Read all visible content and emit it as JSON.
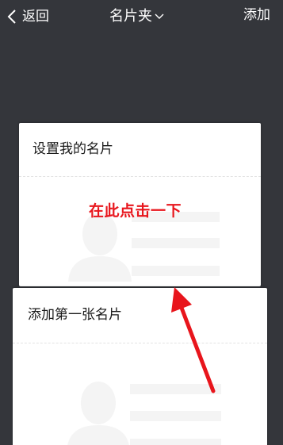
{
  "header": {
    "back_label": "返回",
    "title": "名片夹",
    "add_label": "添加"
  },
  "cards": [
    {
      "title": "设置我的名片"
    },
    {
      "title": "添加第一张名片"
    }
  ],
  "annotation": {
    "text": "在此点击一下",
    "color": "#e8151c"
  },
  "icons": {
    "back": "chevron-left-icon",
    "title_dropdown": "chevron-down-icon",
    "avatar": "person-silhouette-icon"
  },
  "colors": {
    "background": "#34363b",
    "card": "#ffffff",
    "placeholder": "#f4f4f4",
    "annotation": "#e8151c"
  }
}
